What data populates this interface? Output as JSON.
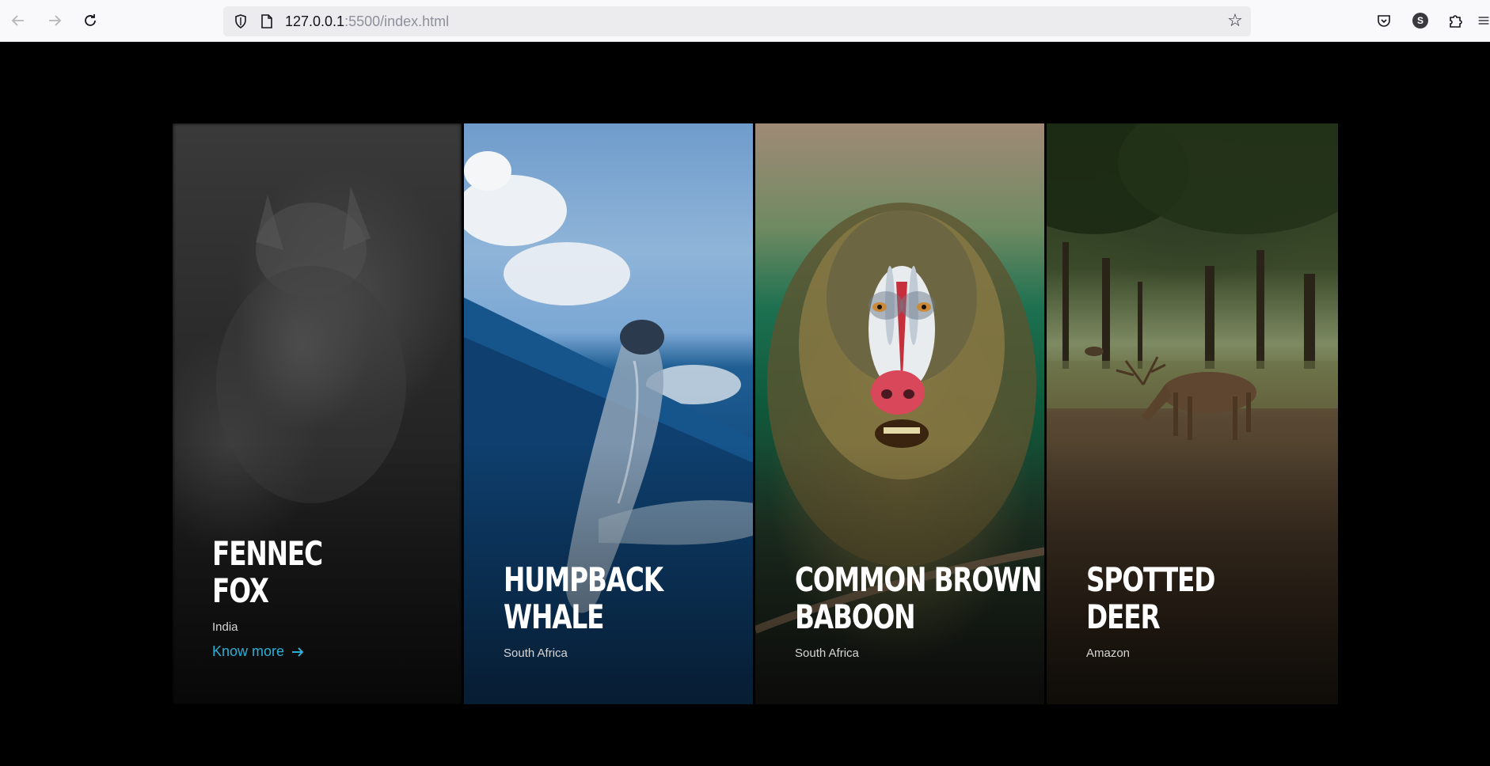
{
  "browser": {
    "url_host": "127.0.0.1",
    "url_path": ":5500/index.html",
    "profile_initial": "S"
  },
  "cards": [
    {
      "title": "FENNEC\nFOX",
      "location": "India",
      "link": "Know more"
    },
    {
      "title": "HUMPBACK\nWHALE",
      "location": "South Africa"
    },
    {
      "title": "COMMON BROWN\nBABOON",
      "location": "South Africa"
    },
    {
      "title": "SPOTTED\nDEER",
      "location": "Amazon"
    }
  ],
  "colors": {
    "background": "#000000",
    "accent": "#2ab0d4",
    "title": "#ffffff",
    "location": "#d6d6d6"
  }
}
